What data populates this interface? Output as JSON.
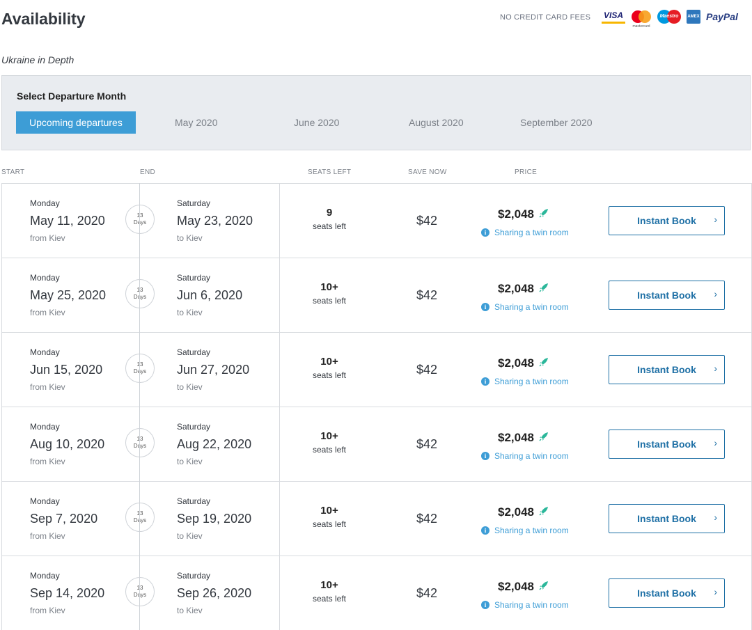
{
  "header": {
    "title": "Availability",
    "fees_note": "NO CREDIT CARD FEES",
    "payment_logos": [
      "VISA",
      "mastercard",
      "Maestro",
      "AMEX",
      "PayPal"
    ]
  },
  "subtitle": "Ukraine in Depth",
  "month_selector": {
    "label": "Select Departure Month",
    "tabs": [
      "Upcoming departures",
      "May 2020",
      "June 2020",
      "August 2020",
      "September 2020"
    ],
    "active_tab": "Upcoming departures"
  },
  "columns": {
    "start": "START",
    "end": "END",
    "seats": "SEATS LEFT",
    "save": "SAVE NOW",
    "price": "PRICE"
  },
  "departures": [
    {
      "start_dow": "Monday",
      "start_date": "May 11, 2020",
      "from": "from Kiev",
      "duration_num": "13",
      "duration_unit": "Days",
      "end_dow": "Saturday",
      "end_date": "May 23, 2020",
      "to": "to Kiev",
      "seats": "9",
      "seats_label": "seats left",
      "save": "$42",
      "price": "$2,048",
      "room": "Sharing a twin room",
      "book": "Instant Book"
    },
    {
      "start_dow": "Monday",
      "start_date": "May 25, 2020",
      "from": "from Kiev",
      "duration_num": "13",
      "duration_unit": "Days",
      "end_dow": "Saturday",
      "end_date": "Jun 6, 2020",
      "to": "to Kiev",
      "seats": "10+",
      "seats_label": "seats left",
      "save": "$42",
      "price": "$2,048",
      "room": "Sharing a twin room",
      "book": "Instant Book"
    },
    {
      "start_dow": "Monday",
      "start_date": "Jun 15, 2020",
      "from": "from Kiev",
      "duration_num": "13",
      "duration_unit": "Days",
      "end_dow": "Saturday",
      "end_date": "Jun 27, 2020",
      "to": "to Kiev",
      "seats": "10+",
      "seats_label": "seats left",
      "save": "$42",
      "price": "$2,048",
      "room": "Sharing a twin room",
      "book": "Instant Book"
    },
    {
      "start_dow": "Monday",
      "start_date": "Aug 10, 2020",
      "from": "from Kiev",
      "duration_num": "13",
      "duration_unit": "Days",
      "end_dow": "Saturday",
      "end_date": "Aug 22, 2020",
      "to": "to Kiev",
      "seats": "10+",
      "seats_label": "seats left",
      "save": "$42",
      "price": "$2,048",
      "room": "Sharing a twin room",
      "book": "Instant Book"
    },
    {
      "start_dow": "Monday",
      "start_date": "Sep 7, 2020",
      "from": "from Kiev",
      "duration_num": "13",
      "duration_unit": "Days",
      "end_dow": "Saturday",
      "end_date": "Sep 19, 2020",
      "to": "to Kiev",
      "seats": "10+",
      "seats_label": "seats left",
      "save": "$42",
      "price": "$2,048",
      "room": "Sharing a twin room",
      "book": "Instant Book"
    },
    {
      "start_dow": "Monday",
      "start_date": "Sep 14, 2020",
      "from": "from Kiev",
      "duration_num": "13",
      "duration_unit": "Days",
      "end_dow": "Saturday",
      "end_date": "Sep 26, 2020",
      "to": "to Kiev",
      "seats": "10+",
      "seats_label": "seats left",
      "save": "$42",
      "price": "$2,048",
      "room": "Sharing a twin room",
      "book": "Instant Book"
    }
  ],
  "colors": {
    "accent": "#3d9dd6",
    "button_border": "#1d6fa5",
    "rocket": "#2bb79a",
    "panel_bg": "#e9ecf0"
  }
}
